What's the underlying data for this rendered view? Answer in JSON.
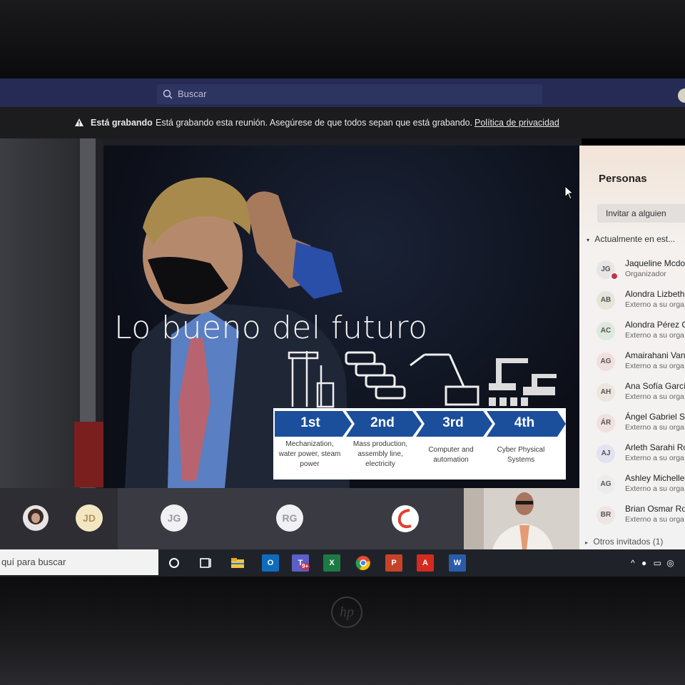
{
  "titlebar": {
    "search_placeholder": "Buscar",
    "search_icon": "search-icon"
  },
  "recording": {
    "icon": "warning-icon",
    "bold": "Está grabando",
    "message": "Está grabando esta reunión. Asegúrese de que todos sepan que está grabando.",
    "link": "Política de privacidad"
  },
  "slide": {
    "title": "Lo bueno del futuro",
    "revolutions": [
      {
        "label": "1st",
        "desc": [
          "Mechanization,",
          "water power, steam",
          "power"
        ]
      },
      {
        "label": "2nd",
        "desc": [
          "Mass production,",
          "assembly line,",
          "electricity"
        ]
      },
      {
        "label": "3rd",
        "desc": [
          "Computer and",
          "automation"
        ]
      },
      {
        "label": "4th",
        "desc": [
          "Cyber Physical",
          "Systems"
        ]
      }
    ]
  },
  "tiles": [
    {
      "initials": "JD"
    },
    {
      "initials": "JG"
    },
    {
      "initials": "RG"
    }
  ],
  "people_panel": {
    "title": "Personas",
    "invite": "Invitar a alguien",
    "section": "Actualmente en est...",
    "others": "Otros invitados (1)",
    "people": [
      {
        "initials": "JG",
        "name": "Jaqueline Mcdo",
        "role": "Organizador"
      },
      {
        "initials": "AB",
        "name": "Alondra Lizbeth",
        "role": "Externo a su orga"
      },
      {
        "initials": "AC",
        "name": "Alondra Pérez C",
        "role": "Externo a su orga"
      },
      {
        "initials": "AG",
        "name": "Amairahani Van",
        "role": "Externo a su orga"
      },
      {
        "initials": "AH",
        "name": "Ana Sofía García",
        "role": "Externo a su orga"
      },
      {
        "initials": "ÁR",
        "name": "Ángel Gabriel S",
        "role": "Externo a su orga"
      },
      {
        "initials": "AJ",
        "name": "Arleth Sarahi Ro",
        "role": "Externo a su orga"
      },
      {
        "initials": "AG",
        "name": "Ashley Michelle",
        "role": "Externo a su orga"
      },
      {
        "initials": "BR",
        "name": "Brian Osmar Rod",
        "role": "Externo a su orga"
      }
    ]
  },
  "taskbar": {
    "search_text": "quí para buscar",
    "apps": [
      "cortana-icon",
      "task-view-icon",
      "file-explorer-icon",
      "outlook-icon",
      "teams-icon",
      "excel-icon",
      "chrome-icon",
      "powerpoint-icon",
      "acrobat-icon",
      "word-icon"
    ],
    "teams_badge": "9+"
  },
  "laptop": {
    "brand": "hp"
  }
}
